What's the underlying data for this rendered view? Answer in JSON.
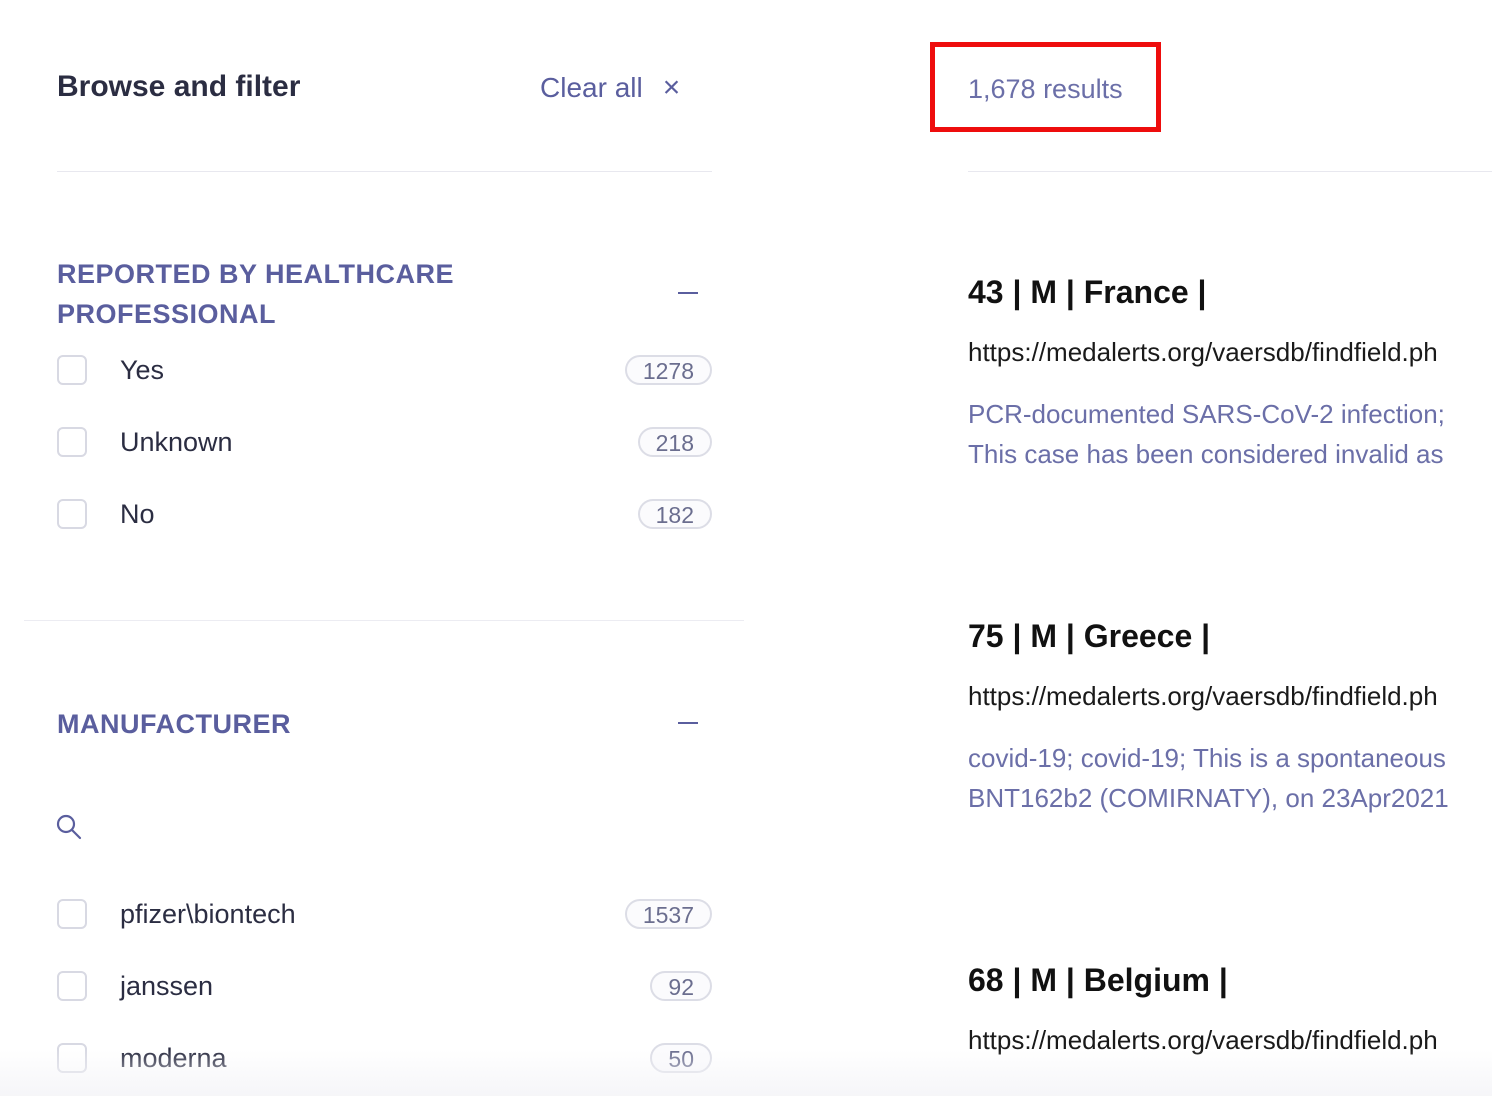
{
  "sidebar": {
    "title": "Browse and filter",
    "clear_all_label": "Clear all",
    "clear_icon": "×",
    "facets": [
      {
        "title_line1": "REPORTED BY HEALTHCARE",
        "title_line2": "PROFESSIONAL",
        "options": [
          {
            "label": "Yes",
            "count": "1278"
          },
          {
            "label": "Unknown",
            "count": "218"
          },
          {
            "label": "No",
            "count": "182"
          }
        ]
      },
      {
        "title_line1": "MANUFACTURER",
        "search_icon": "search-icon",
        "options": [
          {
            "label": "pfizer\\biontech",
            "count": "1537"
          },
          {
            "label": "janssen",
            "count": "92"
          },
          {
            "label": "moderna",
            "count": "50"
          }
        ]
      }
    ]
  },
  "results": {
    "count_label": "1,678 results",
    "items": [
      {
        "title": "43 | M | France |",
        "url": "https://medalerts.org/vaersdb/findfield.ph",
        "snippet_line1": "PCR-documented SARS-CoV-2 infection;",
        "snippet_line2": "This case has been considered invalid as"
      },
      {
        "title": "75 | M | Greece |",
        "url": "https://medalerts.org/vaersdb/findfield.ph",
        "snippet_line1": "covid-19; covid-19; This is a spontaneous",
        "snippet_line2": "BNT162b2 (COMIRNATY), on 23Apr2021"
      },
      {
        "title": "68 | M | Belgium |",
        "url": "https://medalerts.org/vaersdb/findfield.ph"
      }
    ]
  },
  "colors": {
    "accent": "#5a5e9e",
    "highlight": "#ee0d0d"
  }
}
